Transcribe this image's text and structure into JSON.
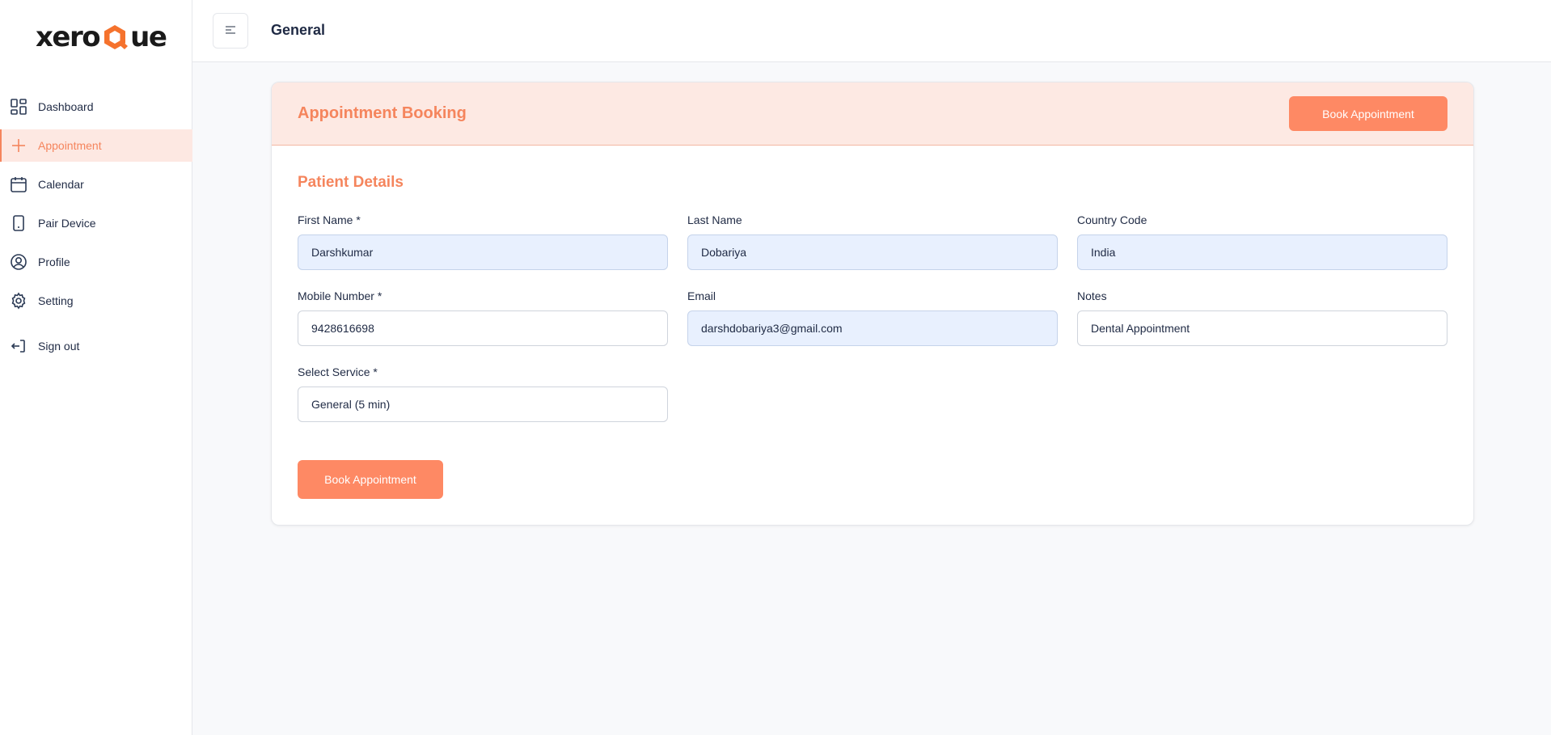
{
  "brand": {
    "logo_left": "xero",
    "logo_right": "ue",
    "accent": "#f5855d",
    "button": "#fe8964",
    "active_bg": "#fde8e2"
  },
  "sidebar": {
    "items": [
      {
        "label": "Dashboard",
        "icon": "dashboard-icon",
        "active": false
      },
      {
        "label": "Appointment",
        "icon": "plus-icon",
        "active": true
      },
      {
        "label": "Calendar",
        "icon": "calendar-icon",
        "active": false
      },
      {
        "label": "Pair Device",
        "icon": "phone-icon",
        "active": false
      },
      {
        "label": "Profile",
        "icon": "user-circle-icon",
        "active": false
      },
      {
        "label": "Setting",
        "icon": "gear-icon",
        "active": false
      }
    ],
    "signout": {
      "label": "Sign out",
      "icon": "sign-out-icon"
    }
  },
  "header": {
    "title": "General",
    "menu_icon": "menu-toggle-icon"
  },
  "card": {
    "title": "Appointment Booking",
    "header_button": "Book Appointment",
    "section_title": "Patient Details",
    "fields": {
      "first_name": {
        "label": "First Name *",
        "value": "Darshkumar"
      },
      "last_name": {
        "label": "Last Name",
        "value": "Dobariya"
      },
      "country_code": {
        "label": "Country Code",
        "value": "India"
      },
      "mobile": {
        "label": "Mobile Number *",
        "value": "9428616698"
      },
      "email": {
        "label": "Email",
        "value": "darshdobariya3@gmail.com"
      },
      "notes": {
        "label": "Notes",
        "value": "Dental Appointment"
      },
      "service": {
        "label": "Select Service *",
        "value": "General (5 min)"
      }
    },
    "submit_button": "Book Appointment"
  }
}
